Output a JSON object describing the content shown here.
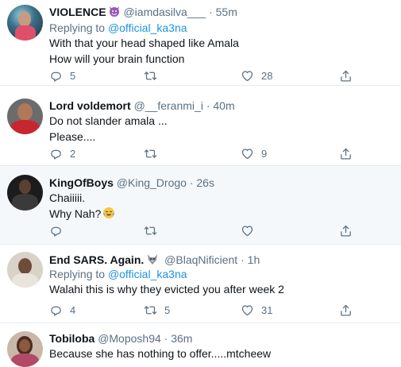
{
  "tweets": [
    {
      "name": "VIOLENCE",
      "handle": "@iamdasilva___",
      "time": "55m",
      "dot": "·",
      "replying_to_prefix": "Replying to",
      "replying_to": "@official_ka3na",
      "lines": [
        "With that your head shaped like Amala",
        "How will your brain function"
      ],
      "replies": "5",
      "retweets": "",
      "likes": "28"
    },
    {
      "name": "Lord voldemort",
      "handle": "@__feranmi_i",
      "time": "40m",
      "dot": "·",
      "lines": [
        "Do not slander amala ...",
        "Please...."
      ],
      "replies": "2",
      "retweets": "",
      "likes": "9"
    },
    {
      "name": "KingOfBoys",
      "handle": "@King_Drogo",
      "time": "26s",
      "dot": "·",
      "lines": [
        "Chaiiiii.",
        "Why Nah?"
      ],
      "replies": "",
      "retweets": "",
      "likes": ""
    },
    {
      "name": "End SARS. Again.",
      "handle": "@BlaqNificient",
      "time": "1h",
      "dot": "·",
      "replying_to_prefix": "Replying to",
      "replying_to": "@official_ka3na",
      "lines": [
        "Walahi this is why they evicted you after week 2"
      ],
      "replies": "4",
      "retweets": "5",
      "likes": "31"
    },
    {
      "name": "Tobiloba",
      "handle": "@Moposh94",
      "time": "36m",
      "dot": "·",
      "lines": [
        "Because she has nothing to offer.....mtcheew"
      ]
    }
  ],
  "colors": {
    "link": "#1b95e0",
    "secondary": "#5b7083",
    "highlight_bg": "#f5f8fa",
    "divider": "#e6ecf0"
  },
  "icons": {
    "reply": "speech-bubble-icon",
    "retweet": "retweet-arrows-icon",
    "like": "heart-icon",
    "share": "share-upload-icon"
  }
}
